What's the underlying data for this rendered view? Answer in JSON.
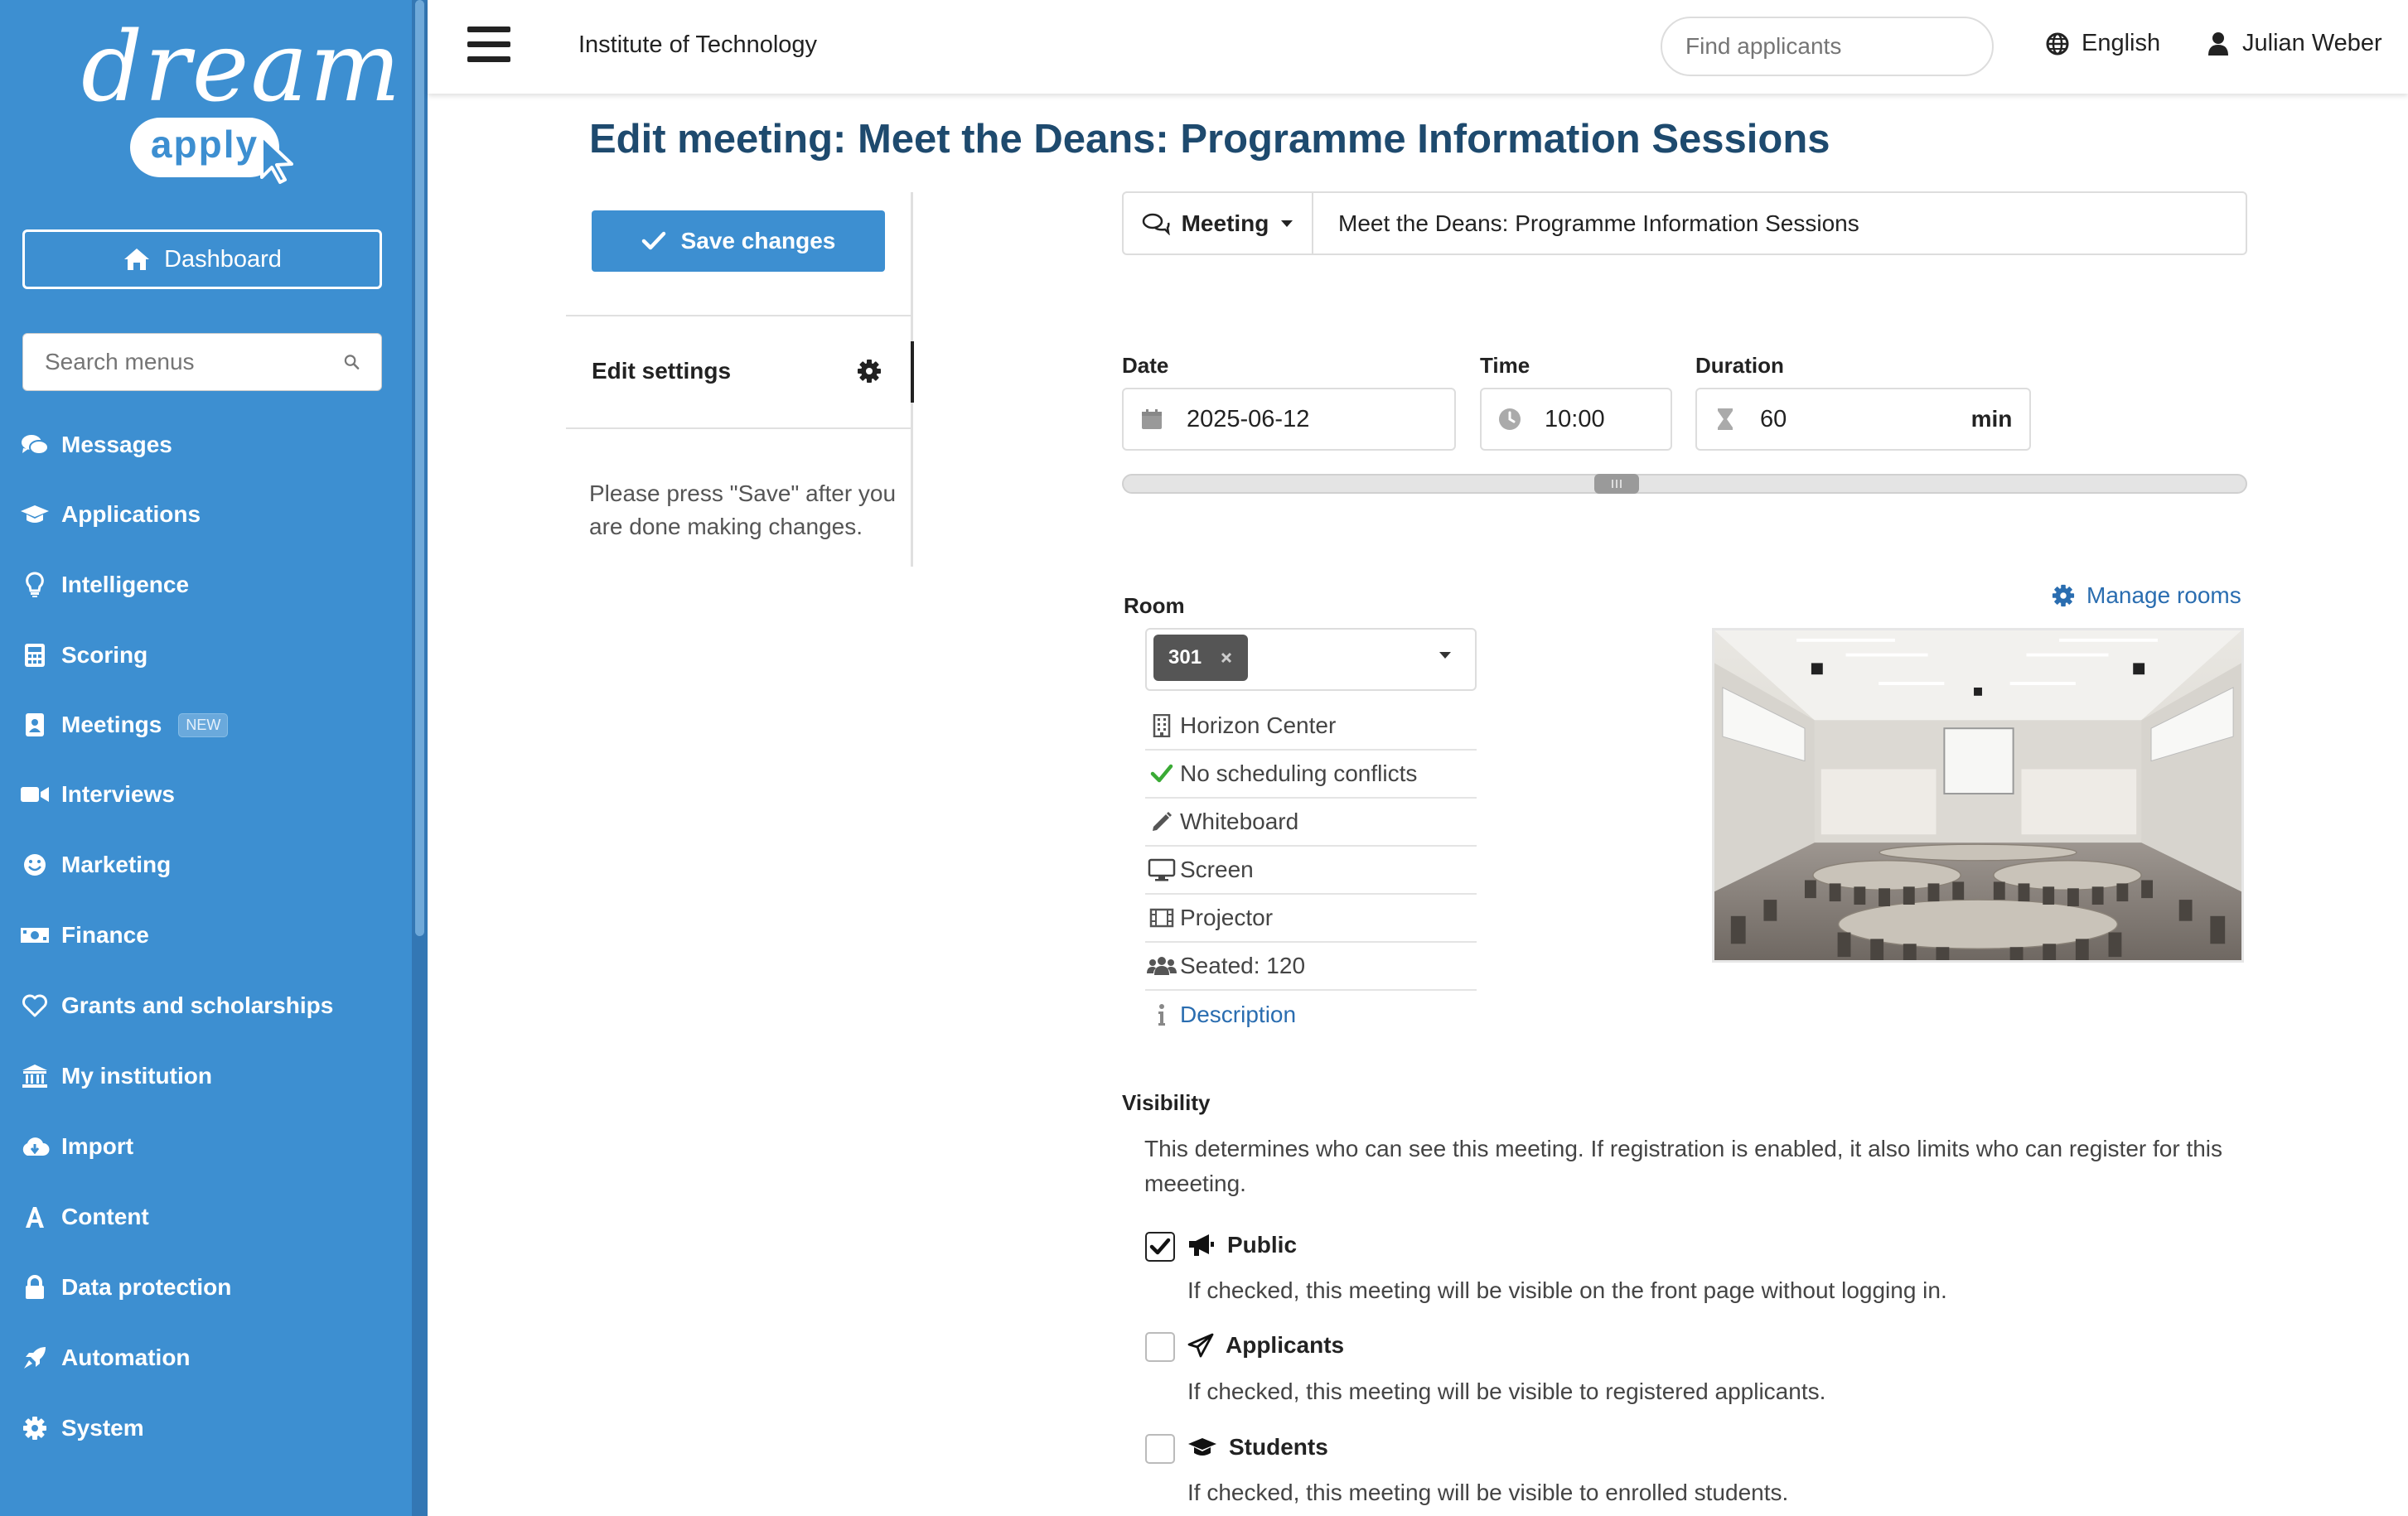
{
  "sidebar": {
    "logo_text": "dream",
    "logo_sub": "apply",
    "dashboard_label": "Dashboard",
    "search_placeholder": "Search menus",
    "items": [
      {
        "label": "Messages",
        "icon": "comments-icon"
      },
      {
        "label": "Applications",
        "icon": "graduation-cap-icon"
      },
      {
        "label": "Intelligence",
        "icon": "lightbulb-icon"
      },
      {
        "label": "Scoring",
        "icon": "calculator-icon"
      },
      {
        "label": "Meetings",
        "icon": "address-book-icon",
        "badge": "NEW"
      },
      {
        "label": "Interviews",
        "icon": "video-camera-icon"
      },
      {
        "label": "Marketing",
        "icon": "smile-icon"
      },
      {
        "label": "Finance",
        "icon": "money-icon"
      },
      {
        "label": "Grants and scholarships",
        "icon": "heart-icon"
      },
      {
        "label": "My institution",
        "icon": "institution-icon"
      },
      {
        "label": "Import",
        "icon": "cloud-download-icon"
      },
      {
        "label": "Content",
        "icon": "font-icon"
      },
      {
        "label": "Data protection",
        "icon": "lock-icon"
      },
      {
        "label": "Automation",
        "icon": "rocket-icon"
      },
      {
        "label": "System",
        "icon": "gear-icon"
      }
    ]
  },
  "topbar": {
    "institution": "Institute of Technology",
    "search_placeholder": "Find applicants",
    "language": "English",
    "user": "Julian Weber"
  },
  "page": {
    "title": "Edit meeting: Meet the Deans: Programme Information Sessions",
    "save_label": "Save changes",
    "edit_settings_label": "Edit settings",
    "hint": "Please press \"Save\" after you are done making changes."
  },
  "meeting": {
    "type_label": "Meeting",
    "name": "Meet the Deans: Programme Information Sessions",
    "date_label": "Date",
    "date": "2025-06-12",
    "time_label": "Time",
    "time": "10:00",
    "duration_label": "Duration",
    "duration": "60",
    "duration_unit": "min"
  },
  "room": {
    "label": "Room",
    "manage_label": "Manage rooms",
    "selected": "301",
    "properties": [
      {
        "text": "Horizon Center",
        "icon": "building-icon"
      },
      {
        "text": "No scheduling conflicts",
        "icon": "check-icon"
      },
      {
        "text": "Whiteboard",
        "icon": "pencil-icon"
      },
      {
        "text": "Screen",
        "icon": "desktop-icon"
      },
      {
        "text": "Projector",
        "icon": "film-icon"
      },
      {
        "text": "Seated: 120",
        "icon": "users-icon"
      }
    ],
    "description_link": "Description"
  },
  "visibility": {
    "label": "Visibility",
    "description": "This determines who can see this meeting. If registration is enabled, it also limits who can register for this meeeting.",
    "options": [
      {
        "title": "Public",
        "desc": "If checked, this meeting will be visible on the front page without logging in.",
        "checked": true,
        "icon": "bullhorn-icon"
      },
      {
        "title": "Applicants",
        "desc": "If checked, this meeting will be visible to registered applicants.",
        "checked": false,
        "icon": "paper-plane-icon"
      },
      {
        "title": "Students",
        "desc": "If checked, this meeting will be visible to enrolled students.",
        "checked": false,
        "icon": "graduation-cap-icon"
      }
    ]
  },
  "colors": {
    "sidebar": "#3d8fd1",
    "title": "#1e4a6e",
    "link": "#2a6db0"
  }
}
